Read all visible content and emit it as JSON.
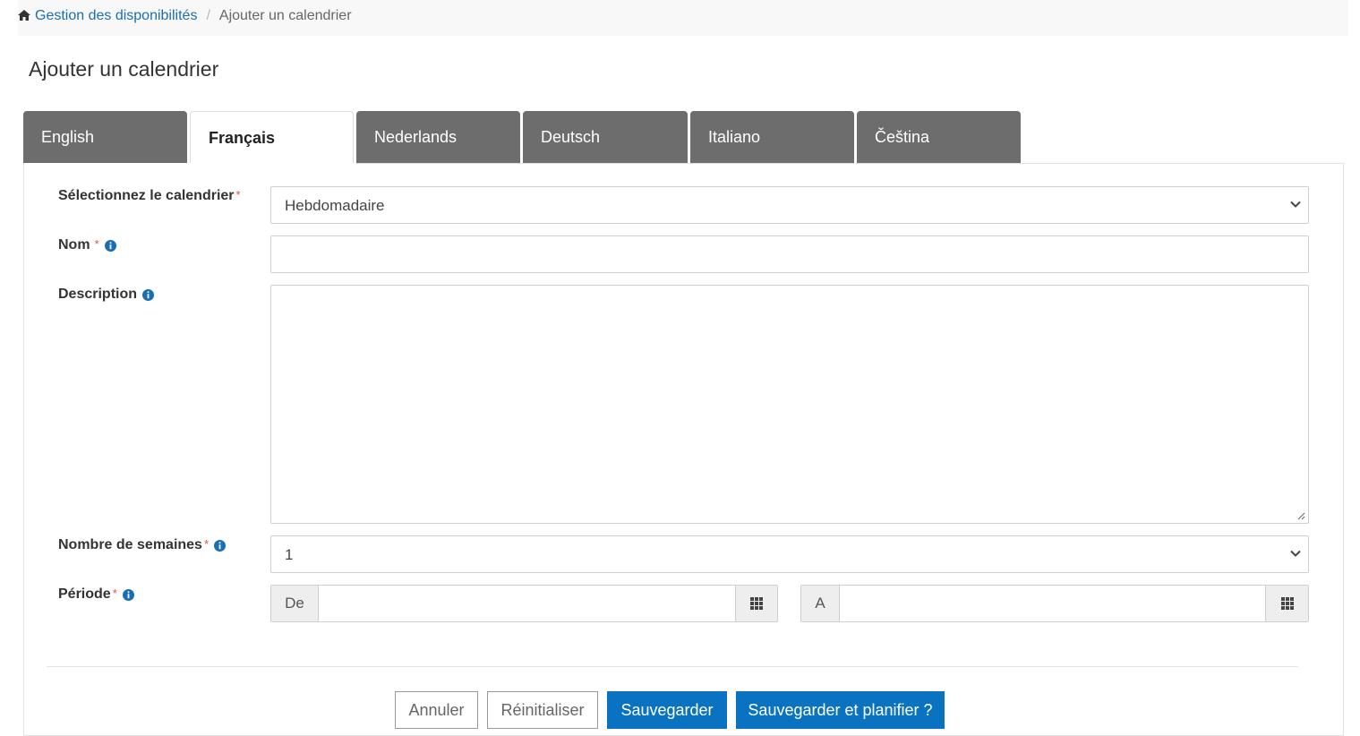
{
  "breadcrumb": {
    "home_label": "Gestion des disponibilités",
    "separator": "/",
    "current": "Ajouter un calendrier"
  },
  "page_title": "Ajouter un calendrier",
  "tabs": [
    {
      "label": "English",
      "active": false
    },
    {
      "label": "Français",
      "active": true
    },
    {
      "label": "Nederlands",
      "active": false
    },
    {
      "label": "Deutsch",
      "active": false
    },
    {
      "label": "Italiano",
      "active": false
    },
    {
      "label": "Čeština",
      "active": false
    }
  ],
  "form": {
    "calendar": {
      "label": "Sélectionnez le calendrier",
      "required_mark": "*",
      "selected": "Hebdomadaire"
    },
    "name": {
      "label": "Nom",
      "required_mark": "*",
      "value": ""
    },
    "description": {
      "label": "Description",
      "value": ""
    },
    "weeks": {
      "label": "Nombre de semaines",
      "required_mark": "*",
      "selected": "1"
    },
    "period": {
      "label": "Période",
      "required_mark": "*",
      "from_label": "De",
      "to_label": "A",
      "from_value": "",
      "to_value": ""
    }
  },
  "buttons": {
    "cancel": "Annuler",
    "reset": "Réinitialiser",
    "save": "Sauvegarder",
    "save_plan": "Sauvegarder et planifier ?"
  },
  "colors": {
    "link": "#1a6fb3",
    "tab_inactive": "#6d6d6d",
    "primary": "#0a73c1",
    "required": "#d9534f",
    "info": "#1a6fb3"
  },
  "icons": {
    "home": "home-icon",
    "info": "info-icon",
    "chevron": "chevron-down-icon",
    "calendar_grid": "grid-icon"
  }
}
